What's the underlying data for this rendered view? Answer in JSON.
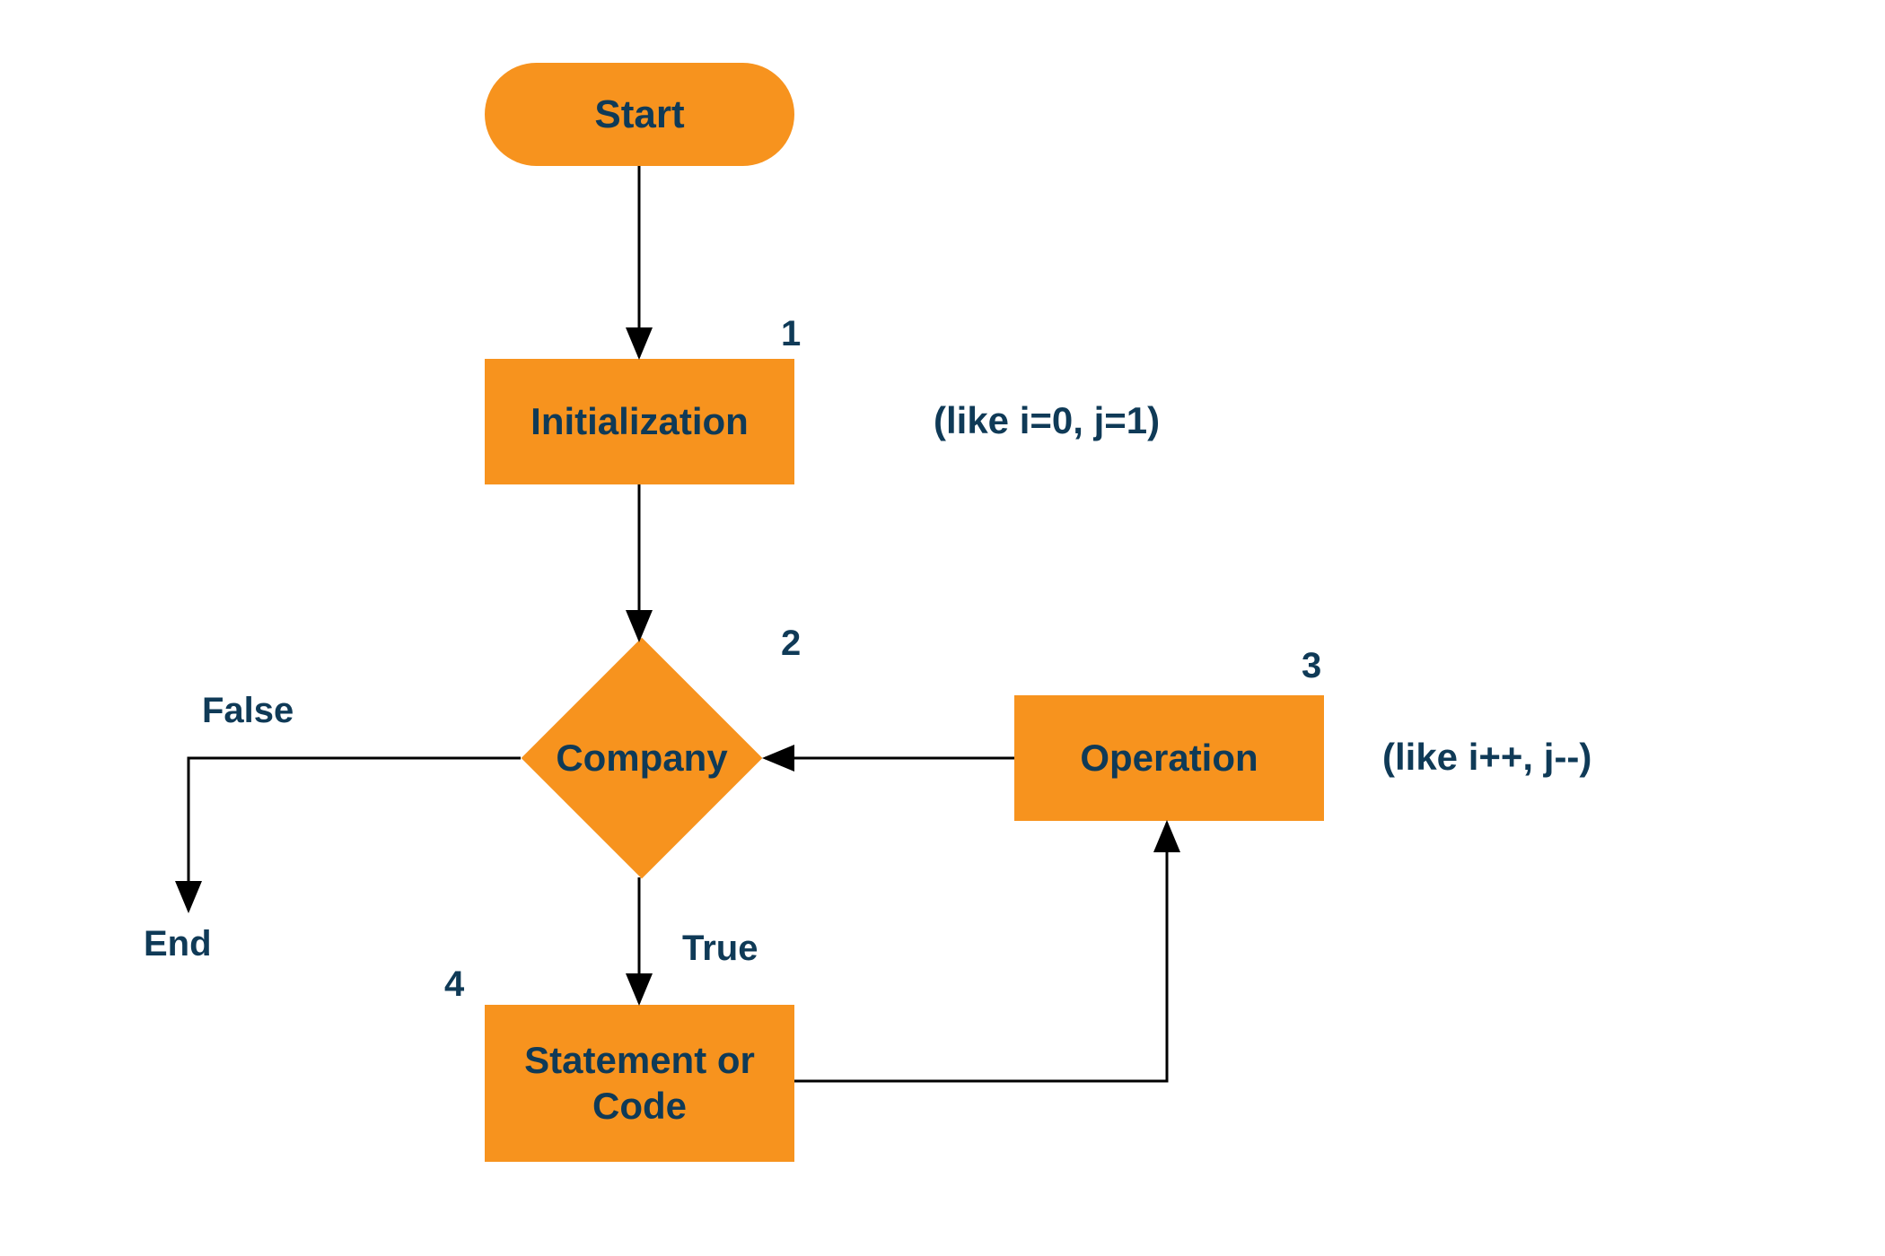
{
  "colors": {
    "accent": "#f7931e",
    "text": "#0f3a57"
  },
  "nodes": {
    "start": {
      "label": "Start"
    },
    "init": {
      "label": "Initialization",
      "number": "1",
      "annotation": "(like i=0, j=1)"
    },
    "decision": {
      "label": "Company",
      "number": "2"
    },
    "op": {
      "label": "Operation",
      "number": "3",
      "annotation": "(like i++, j--)"
    },
    "stmt": {
      "label": "Statement or Code",
      "number": "4"
    }
  },
  "edges": {
    "false_label": "False",
    "true_label": "True",
    "end_label": "End"
  }
}
